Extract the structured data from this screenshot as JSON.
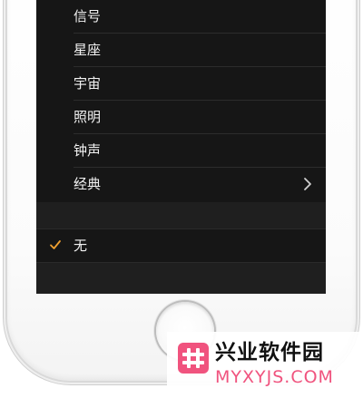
{
  "menu": {
    "items": [
      {
        "label": "信号"
      },
      {
        "label": "星座"
      },
      {
        "label": "宇宙"
      },
      {
        "label": "照明"
      },
      {
        "label": "钟声"
      },
      {
        "label": "经典"
      }
    ],
    "classic_has_chevron": true
  },
  "none_option": {
    "label": "无",
    "selected": true
  },
  "colors": {
    "screen_bg": "#161616",
    "text": "#f2f2f2",
    "checkmark": "#f0a030",
    "watermark_accent": "#f0537e"
  },
  "watermark": {
    "title": "兴业软件园",
    "url": "MYXYJS.COM"
  },
  "icons": {
    "chevron": "chevron-right-icon",
    "check": "checkmark-icon",
    "home": "home-button"
  }
}
